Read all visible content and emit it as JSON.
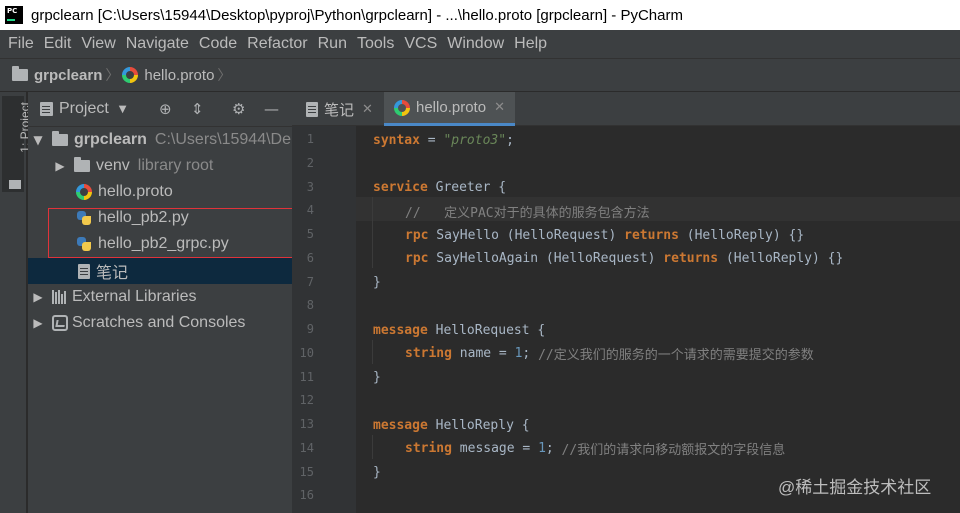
{
  "window": {
    "title": "grpclearn [C:\\Users\\15944\\Desktop\\pyproj\\Python\\grpclearn] - ...\\hello.proto [grpclearn] - PyCharm"
  },
  "menu": [
    "File",
    "Edit",
    "View",
    "Navigate",
    "Code",
    "Refactor",
    "Run",
    "Tools",
    "VCS",
    "Window",
    "Help"
  ],
  "breadcrumb": {
    "project": "grpclearn",
    "file": "hello.proto"
  },
  "toolstrip": {
    "label": "1: Project"
  },
  "project_panel": {
    "title": "Project",
    "tree": [
      {
        "label": "grpclearn",
        "hint": "C:\\Users\\15944\\De",
        "kind": "folder",
        "expanded": true
      },
      {
        "label": "venv",
        "hint": "library root",
        "kind": "folder",
        "expanded": false
      },
      {
        "label": "hello.proto",
        "kind": "proto"
      },
      {
        "label": "hello_pb2.py",
        "kind": "python"
      },
      {
        "label": "hello_pb2_grpc.py",
        "kind": "python"
      },
      {
        "label": "笔记",
        "kind": "note",
        "selected": true
      },
      {
        "label": "External Libraries",
        "kind": "library",
        "expanded": false
      },
      {
        "label": "Scratches and Consoles",
        "kind": "scratch",
        "expanded": false
      }
    ]
  },
  "tabs": [
    {
      "label": "笔记",
      "active": false
    },
    {
      "label": "hello.proto",
      "active": true
    }
  ],
  "editor": {
    "line_numbers": [
      "1",
      "2",
      "3",
      "4",
      "5",
      "6",
      "7",
      "8",
      "9",
      "10",
      "11",
      "12",
      "13",
      "14",
      "15",
      "16"
    ],
    "code": {
      "l1_kw": "syntax",
      "l1_rest": " = ",
      "l1_str": "\"proto3\"",
      "l1_end": ";",
      "l3_kw": "service",
      "l3_rest": " Greeter {",
      "l4_comment": "//   定义PAC对于的具体的服务包含方法",
      "l5_rpc": "rpc",
      "l5_a": " SayHello (HelloRequest) ",
      "l5_ret": "returns",
      "l5_b": " (HelloReply) {}",
      "l6_rpc": "rpc",
      "l6_a": " SayHelloAgain (HelloRequest) ",
      "l6_ret": "returns",
      "l6_b": " (HelloReply) {}",
      "l7": "}",
      "l9_kw": "message",
      "l9_rest": " HelloRequest {",
      "l10_type": "string",
      "l10_a": " name = ",
      "l10_num": "1",
      "l10_b": "; ",
      "l10_comment": "//定义我们的服务的一个请求的需要提交的参数",
      "l11": "}",
      "l13_kw": "message",
      "l13_rest": " HelloReply {",
      "l14_type": "string",
      "l14_a": " message = ",
      "l14_num": "1",
      "l14_b": "; ",
      "l14_comment": "//我们的请求向移动额报文的字段信息",
      "l15": "}"
    }
  },
  "watermark": "@稀土掘金技术社区",
  "colors": {
    "keyword": "#cc7832",
    "string": "#6a8759",
    "number": "#6897bb",
    "comment": "#808080",
    "highlight_box": "#e0333a"
  }
}
